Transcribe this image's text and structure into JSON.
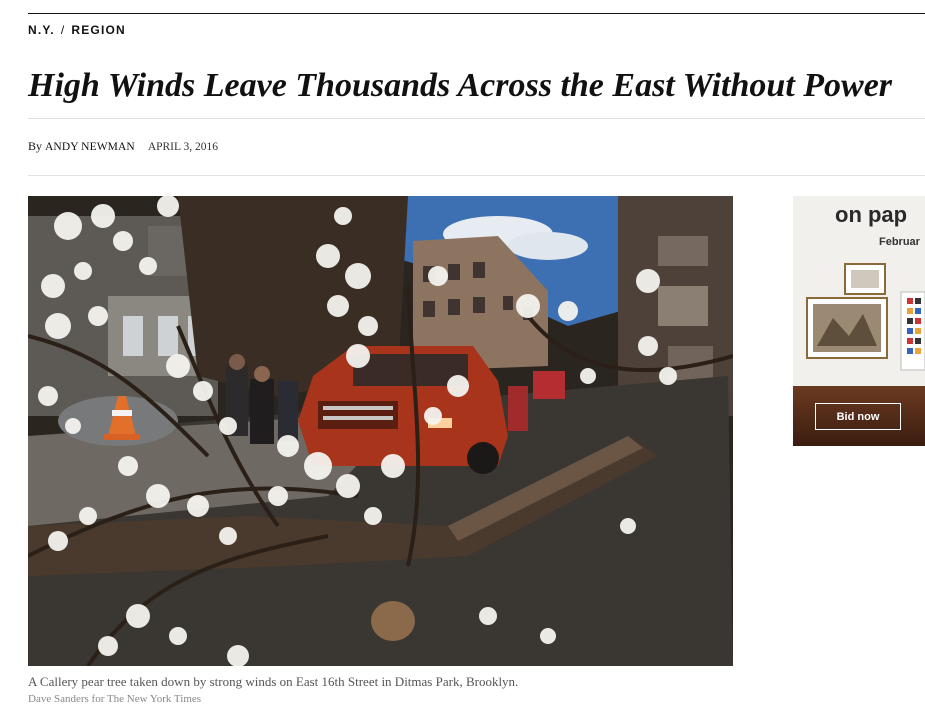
{
  "section": {
    "primary": "N.Y.",
    "separator": "/",
    "secondary": "REGION"
  },
  "article": {
    "headline": "High Winds Leave Thousands Across the East Without Power",
    "byline_prefix": "By",
    "author": "ANDY NEWMAN",
    "date": "APRIL 3, 2016"
  },
  "photo": {
    "caption": "A Callery pear tree taken down by strong winds on East 16th Street in Ditmas Park, Brooklyn.",
    "credit": "Dave Sanders for The New York Times"
  },
  "ad": {
    "title": "on pap",
    "subtitle": "Februar",
    "button_label": "Bid now"
  }
}
